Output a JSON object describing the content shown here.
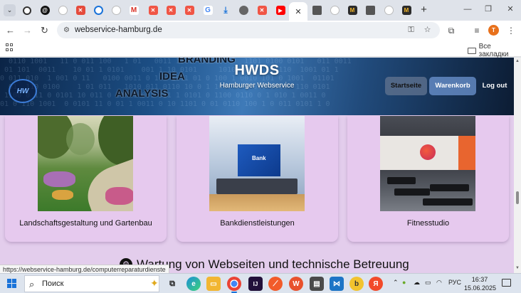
{
  "browser": {
    "tabs_count_hint": "many",
    "url": "webservice-hamburg.de",
    "new_tab_label": "+",
    "bookmarks_all_label": "Все закладки",
    "profile_initial": "T",
    "status_url": "https://webservice-hamburg.de/computerreparaturdienste"
  },
  "site": {
    "title": "HWDS",
    "subtitle": "Hamburger Webservice",
    "hero_words": [
      "BRANDING",
      "IDEA",
      "ANALYSIS"
    ],
    "nav": [
      {
        "label": "Startseite",
        "active": true
      },
      {
        "label": "Warenkorb",
        "active": false
      },
      {
        "label": "Log out",
        "active": false
      }
    ],
    "cards": [
      {
        "caption": "Landschaftsgestaltung und Gartenbau",
        "image": "garden-image"
      },
      {
        "caption": "Bankdienstleistungen",
        "image": "bank-image",
        "sign": "Bank"
      },
      {
        "caption": "Fitnesstudio",
        "image": "gym-image"
      }
    ],
    "section_heading": "Wartung von Webseiten und technische Betreuung"
  },
  "taskbar": {
    "search_placeholder": "Поиск",
    "language": "РУС",
    "time": "16:37",
    "date": "15.06.2025"
  },
  "colors": {
    "page_bg": "#e3cdec",
    "card_bg": "#e6c9ee",
    "hero_accent": "#1c4f86",
    "nav_button": "#5b88c4"
  }
}
